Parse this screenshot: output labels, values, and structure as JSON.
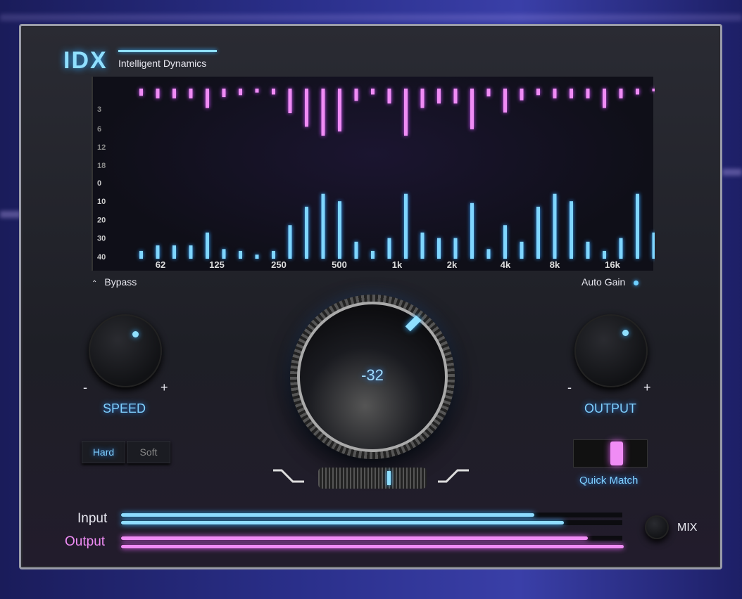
{
  "header": {
    "logo": "IDX",
    "subtitle": "Intelligent Dynamics"
  },
  "spectrum": {
    "reduction_axis": [
      "3",
      "6",
      "12",
      "18"
    ],
    "level_axis": [
      "0",
      "10",
      "20",
      "30",
      "40"
    ],
    "freq_labels": [
      "62",
      "125",
      "250",
      "500",
      "1k",
      "2k",
      "4k",
      "8k",
      "16k"
    ],
    "colors": {
      "reduction": "#f08cf5",
      "level": "#7fd6ff"
    }
  },
  "chart_data": {
    "type": "bar",
    "reduction_db": [
      0.9,
      1.3,
      1.3,
      1.3,
      2.8,
      1.1,
      0.8,
      0.4,
      0.7,
      3.6,
      5.7,
      8.3,
      6.9,
      1.7,
      0.7,
      2.1,
      8.3,
      2.8,
      2.1,
      2.1,
      6.2,
      1.0,
      3.5,
      1.6,
      0.8,
      1.3,
      1.3,
      1.3,
      2.8,
      1.3,
      0.7,
      0.2
    ],
    "level_db": [
      37,
      34,
      34,
      34,
      27,
      36,
      37,
      39,
      37,
      23,
      13,
      6,
      10,
      32,
      37,
      30,
      6,
      27,
      30,
      30,
      11,
      36,
      23,
      32,
      13,
      6,
      10,
      32,
      37,
      30,
      6,
      27
    ]
  },
  "controls": {
    "bypass": {
      "label": "Bypass",
      "icon": "chevron-up-icon"
    },
    "auto_gain": {
      "label": "Auto Gain",
      "on": true
    },
    "speed": {
      "label": "SPEED",
      "minus": "-",
      "plus": "+"
    },
    "output": {
      "label": "OUTPUT",
      "minus": "-",
      "plus": "+"
    },
    "threshold": {
      "value": "-32"
    },
    "knee": {
      "hard": "Hard",
      "soft": "Soft",
      "selected": "Hard"
    },
    "quick_match": {
      "label": "Quick Match"
    },
    "mix": {
      "label": "MIX"
    }
  },
  "meters": {
    "input_label": "Input",
    "output_label": "Output",
    "input_levels": [
      0.69,
      0.74
    ],
    "output_levels": [
      0.78,
      0.84
    ]
  }
}
